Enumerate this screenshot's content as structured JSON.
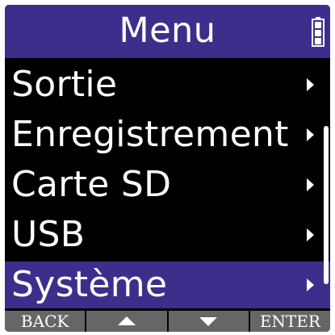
{
  "header": {
    "title": "Menu",
    "battery_icon": "battery-full-icon"
  },
  "menu": {
    "items": [
      {
        "label": "Sortie",
        "selected": false
      },
      {
        "label": "Enregistrement",
        "selected": false
      },
      {
        "label": "Carte SD",
        "selected": false
      },
      {
        "label": "USB",
        "selected": false
      },
      {
        "label": "Système",
        "selected": true
      }
    ]
  },
  "footer": {
    "back_label": "BACK",
    "up_icon": "up-arrow-icon",
    "down_icon": "down-arrow-icon",
    "enter_label": "ENTER"
  },
  "colors": {
    "accent": "#3e2e8c",
    "background": "#000000",
    "text": "#ffffff",
    "footer_button": "#666666"
  }
}
